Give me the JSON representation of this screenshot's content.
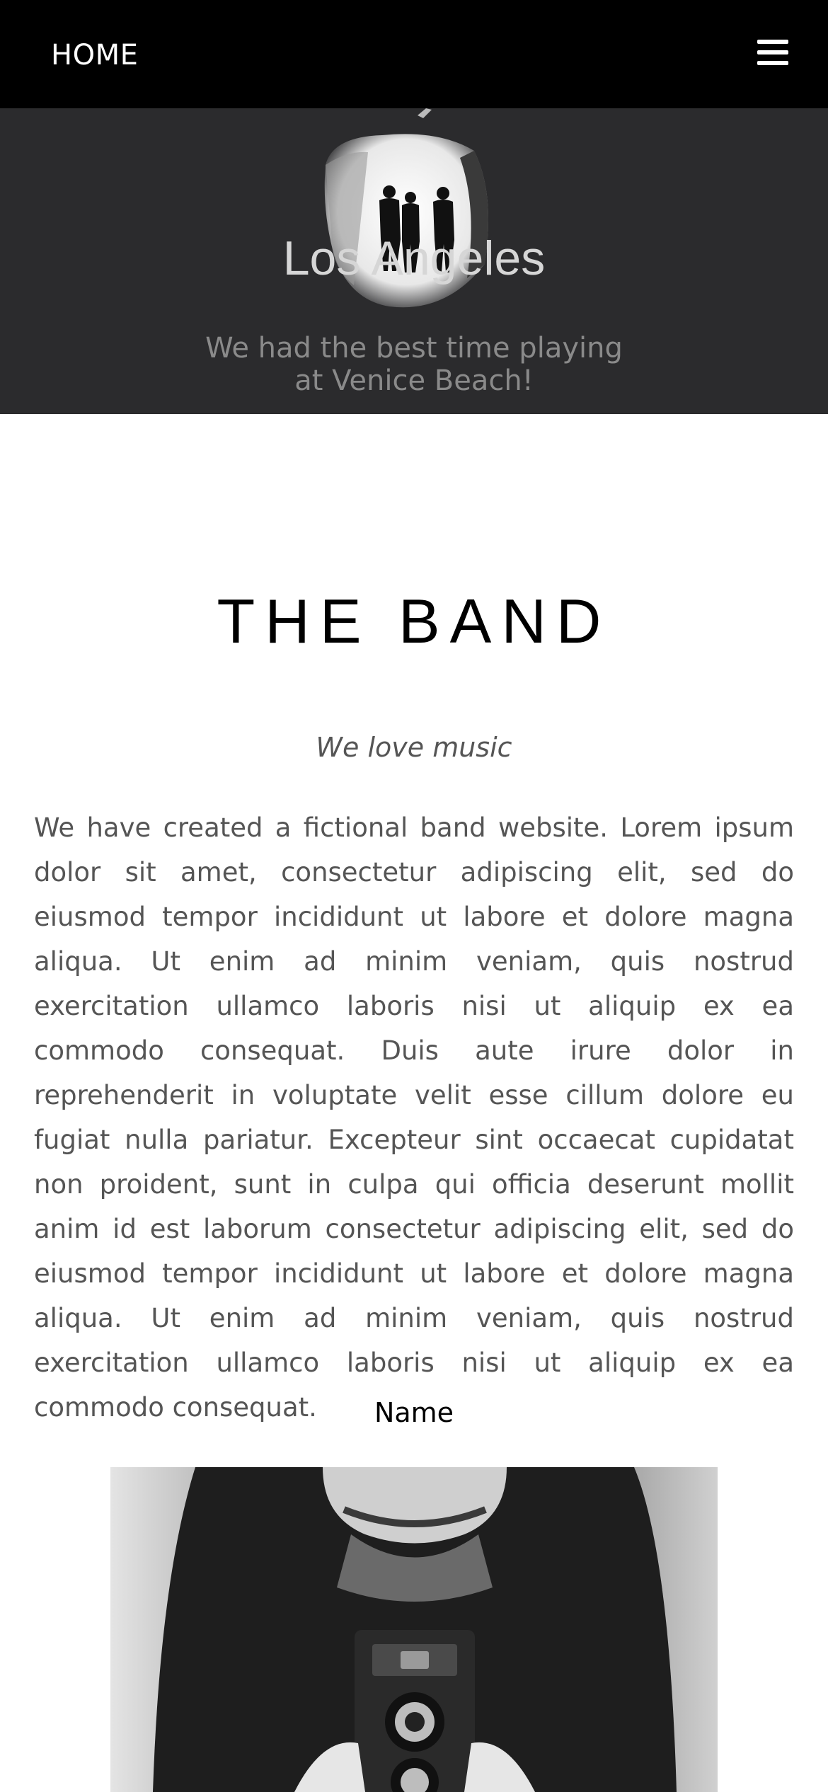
{
  "nav": {
    "home_label": "HOME",
    "menu_icon": "hamburger-menu-icon"
  },
  "hero": {
    "title": "Los Angeles",
    "subtitle": "We had the best time playing at Venice Beach!"
  },
  "band": {
    "title": "THE BAND",
    "tagline": "We love music",
    "body": "We have created a fictional band website. Lorem ipsum dolor sit amet, consectetur adipiscing elit, sed do eiusmod tempor incididunt ut labore et dolore magna aliqua. Ut enim ad minim veniam, quis nostrud exercitation ullamco laboris nisi ut aliquip ex ea commodo consequat. Duis aute irure dolor in reprehenderit in voluptate velit esse cillum dolore eu fugiat nulla pariatur. Excepteur sint occaecat cupidatat non proident, sunt in culpa qui officia deserunt mollit anim id est laborum consectetur adipiscing elit, sed do eiusmod tempor incididunt ut labore et dolore magna aliqua. Ut enim ad minim veniam, quis nostrud exercitation ullamco laboris nisi ut aliquip ex ea commodo consequat."
  },
  "member": {
    "name": "Name"
  }
}
